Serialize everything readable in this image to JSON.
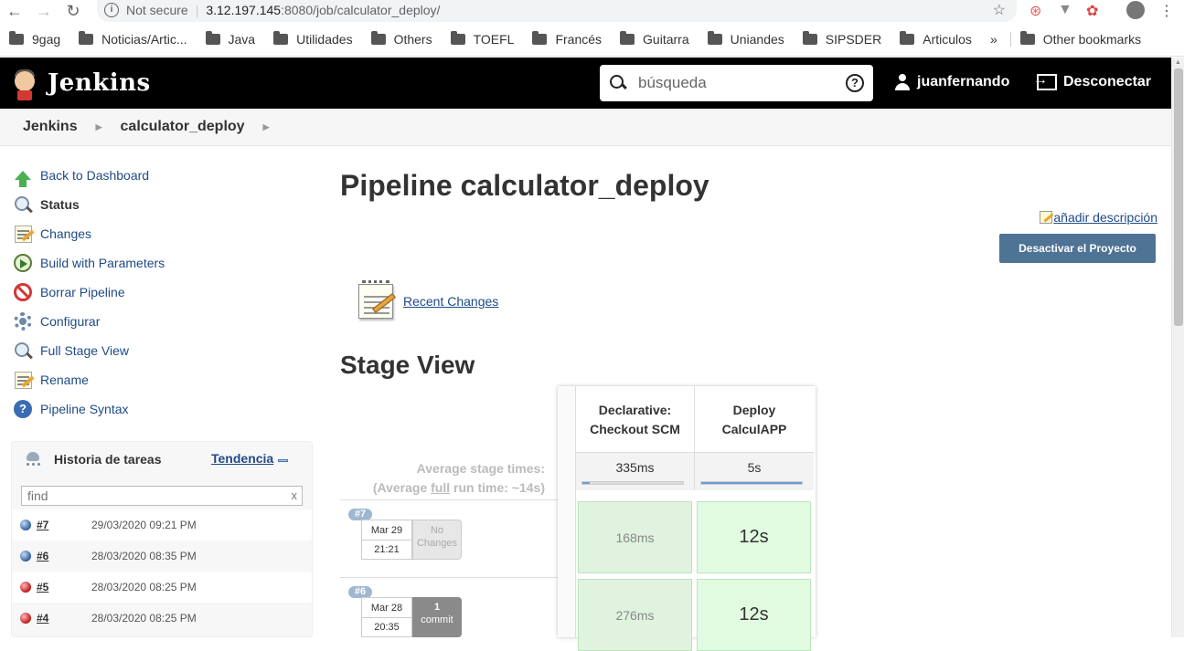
{
  "browser": {
    "security_label": "Not secure",
    "url_host": "3.12.197.145",
    "url_path": ":8080/job/calculator_deploy/",
    "bookmarks": [
      "9gag",
      "Noticias/Artic...",
      "Java",
      "Utilidades",
      "Others",
      "TOEFL",
      "Francés",
      "Guitarra",
      "Uniandes",
      "SIPSDER",
      "Articulos"
    ],
    "overflow": "»",
    "other_bookmarks": "Other bookmarks"
  },
  "header": {
    "logo_text": "Jenkins",
    "search_placeholder": "búsqueda",
    "username": "juanfernando",
    "logout_label": "Desconectar"
  },
  "breadcrumb": {
    "items": [
      "Jenkins",
      "calculator_deploy"
    ]
  },
  "sidebar": {
    "tasks": [
      {
        "label": "Back to Dashboard",
        "icon": "up-arrow-icon"
      },
      {
        "label": "Status",
        "icon": "search-icon"
      },
      {
        "label": "Changes",
        "icon": "notepad-icon"
      },
      {
        "label": "Build with Parameters",
        "icon": "clock-run-icon"
      },
      {
        "label": "Borrar Pipeline",
        "icon": "no-entry-icon"
      },
      {
        "label": "Configurar",
        "icon": "gear-icon"
      },
      {
        "label": "Full Stage View",
        "icon": "search-icon"
      },
      {
        "label": "Rename",
        "icon": "notepad-icon"
      },
      {
        "label": "Pipeline Syntax",
        "icon": "help-icon"
      }
    ]
  },
  "history": {
    "title": "Historia de tareas",
    "trend_label": "Tendencia",
    "find_placeholder": "find",
    "clear_label": "x",
    "builds": [
      {
        "num": "#7",
        "date": "29/03/2020 09:21 PM",
        "status": "blue"
      },
      {
        "num": "#6",
        "date": "28/03/2020 08:35 PM",
        "status": "blue"
      },
      {
        "num": "#5",
        "date": "28/03/2020 08:25 PM",
        "status": "red"
      },
      {
        "num": "#4",
        "date": "28/03/2020 08:25 PM",
        "status": "red"
      }
    ]
  },
  "main": {
    "title": "Pipeline calculator_deploy",
    "add_description": "añadir descripción",
    "disable_button": "Desactivar el Proyecto",
    "recent_changes": "Recent Changes",
    "stage_view_title": "Stage View",
    "avg_label_1": "Average stage times:",
    "avg_label_2_pre": "(Average ",
    "avg_label_2_link": "full",
    "avg_label_2_post": " run time: ~14s)"
  },
  "stages": {
    "columns": [
      {
        "name_line1": "Declarative:",
        "name_line2": "Checkout SCM",
        "avg": "335ms",
        "avg_fill": 0.07
      },
      {
        "name_line1": "Deploy",
        "name_line2": "CalculAPP",
        "avg": "5s",
        "avg_fill": 1.0
      }
    ],
    "runs": [
      {
        "badge": "#7",
        "month_day": "Mar 29",
        "time": "21:21",
        "changes_type": "none",
        "changes_line1": "No",
        "changes_line2": "Changes",
        "cells": [
          "168ms",
          "12s"
        ]
      },
      {
        "badge": "#6",
        "month_day": "Mar 28",
        "time": "20:35",
        "changes_type": "commit",
        "changes_line1": "1",
        "changes_line2": "commit",
        "cells": [
          "276ms",
          "12s"
        ]
      }
    ]
  }
}
